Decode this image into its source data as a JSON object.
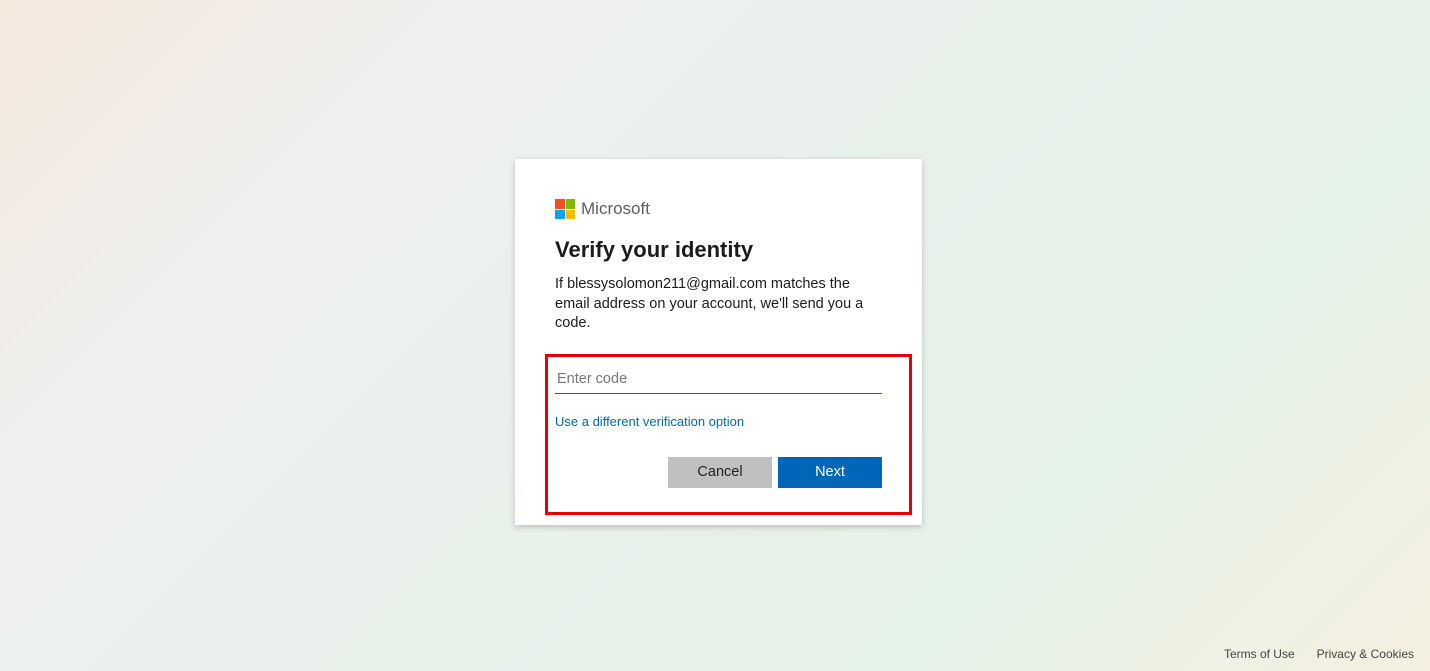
{
  "brand": {
    "name": "Microsoft"
  },
  "card": {
    "heading": "Verify your identity",
    "description": "If blessysolomon211@gmail.com matches the email address on your account, we'll send you a code.",
    "code_placeholder": "Enter code",
    "alt_link_label": "Use a different verification option",
    "cancel_label": "Cancel",
    "next_label": "Next"
  },
  "footer": {
    "terms_label": "Terms of Use",
    "privacy_label": "Privacy & Cookies"
  }
}
